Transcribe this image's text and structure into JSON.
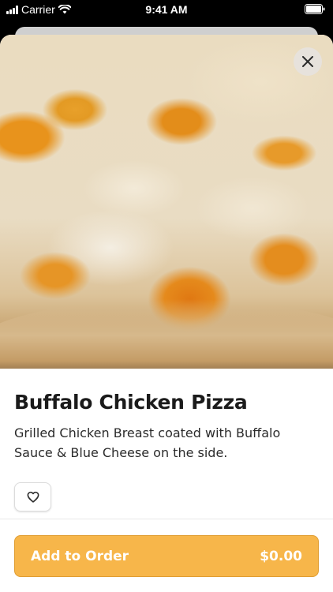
{
  "status_bar": {
    "carrier": "Carrier",
    "time": "9:41 AM",
    "icons": [
      "signal-bars-icon",
      "wifi-icon",
      "battery-icon"
    ]
  },
  "item": {
    "image_alt": "Buffalo Chicken Pizza",
    "title": "Buffalo Chicken Pizza",
    "description": "Grilled Chicken Breast coated with Buffalo Sauce & Blue Cheese on the side."
  },
  "actions": {
    "close_icon": "close-icon",
    "favorite_icon": "heart-icon",
    "add_to_order_label": "Add to Order",
    "price": "$0.00"
  },
  "colors": {
    "accent": "#f7b64a",
    "accent_border": "#e09d31",
    "text": "#1b1b1b"
  }
}
